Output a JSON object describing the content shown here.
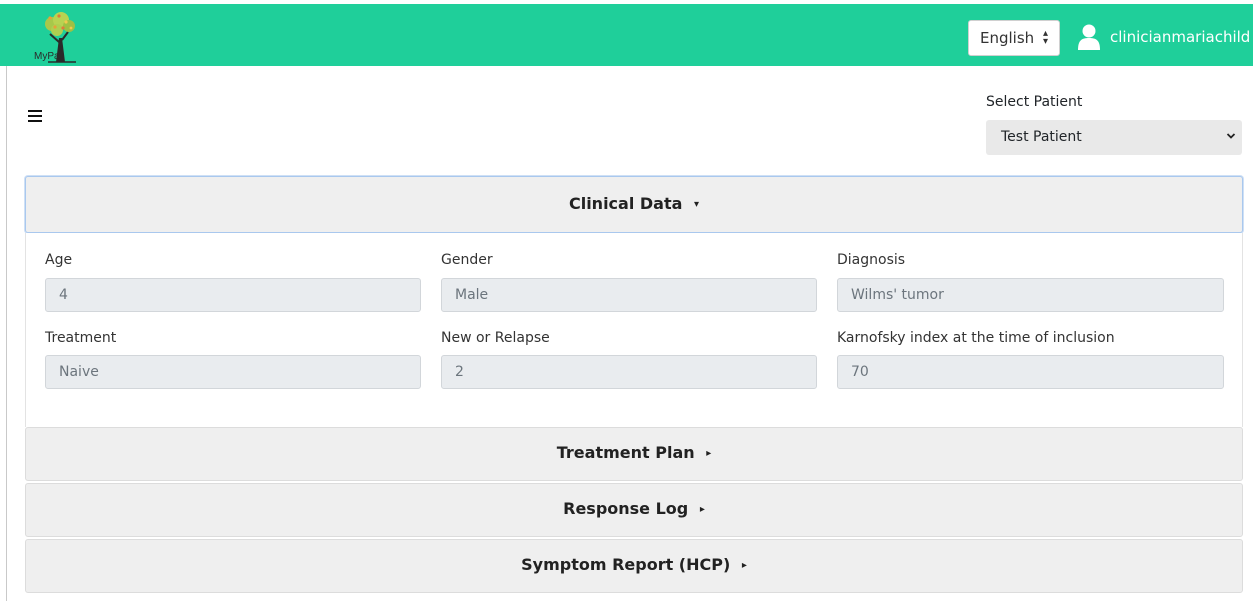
{
  "header": {
    "logo_text": "MyPal",
    "language": "English",
    "username": "clinicianmariachild"
  },
  "patient_selector": {
    "label": "Select Patient",
    "selected": "Test Patient"
  },
  "accordion": {
    "clinical_data": {
      "title": "Clinical Data",
      "fields": [
        {
          "label": "Age",
          "value": "4"
        },
        {
          "label": "Gender",
          "value": "Male"
        },
        {
          "label": "Diagnosis",
          "value": "Wilms' tumor"
        },
        {
          "label": "Treatment",
          "value": "Naive"
        },
        {
          "label": "New or Relapse",
          "value": "2"
        },
        {
          "label": "Karnofsky index at the time of inclusion",
          "value": "70"
        }
      ]
    },
    "treatment_plan": {
      "title": "Treatment Plan"
    },
    "response_log": {
      "title": "Response Log"
    },
    "symptom_report": {
      "title": "Symptom Report (HCP)"
    }
  },
  "colors": {
    "topbar": "#1fcf9a",
    "accordion_header": "#efefef",
    "input_bg": "#e9ecef"
  }
}
